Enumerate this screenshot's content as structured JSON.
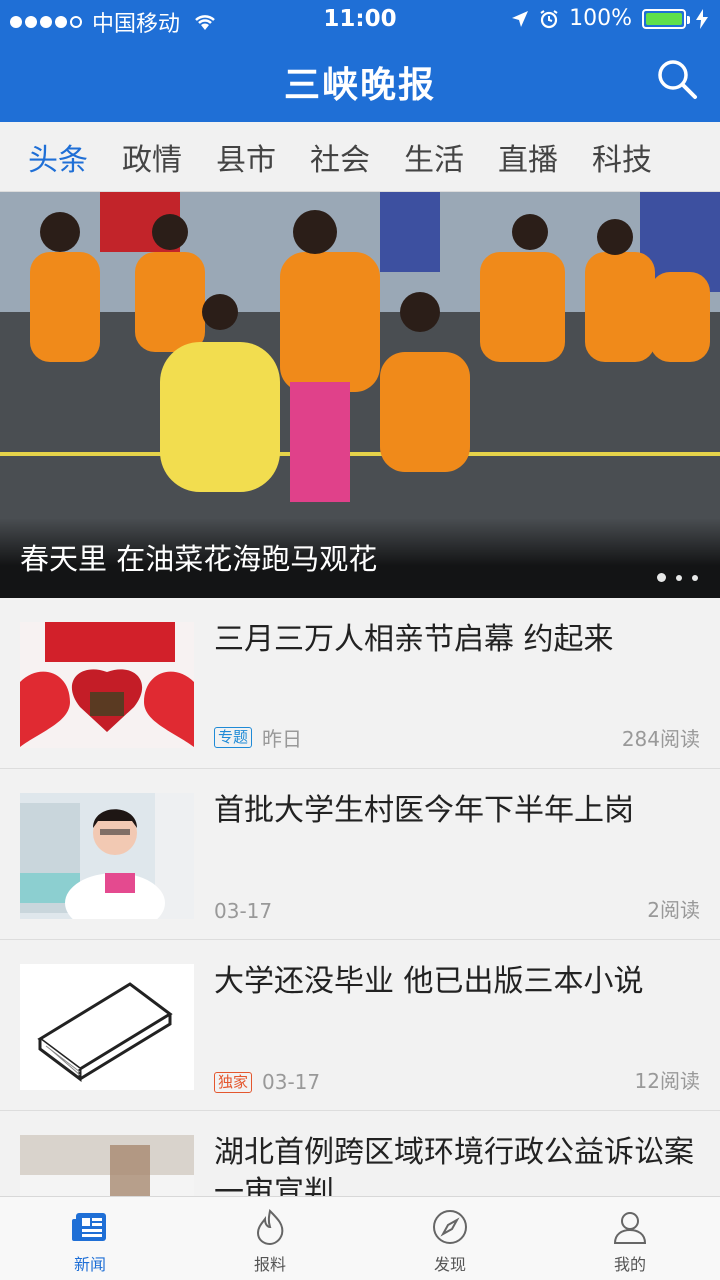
{
  "status": {
    "carrier": "中国移动",
    "time": "11:00",
    "battery": "100%",
    "signal_bars": 4,
    "battery_level": 1.0
  },
  "header": {
    "title": "三峡晚报",
    "search_icon": "search-icon",
    "background": "#1f6fd6"
  },
  "tabs": [
    {
      "label": "头条",
      "active": true
    },
    {
      "label": "政情"
    },
    {
      "label": "县市"
    },
    {
      "label": "社会"
    },
    {
      "label": "生活"
    },
    {
      "label": "直播"
    },
    {
      "label": "科技"
    }
  ],
  "hero": {
    "caption": "春天里 在油菜花海跑马观花",
    "page_count": 3,
    "current_page": 1
  },
  "news": [
    {
      "title": "三月三万人相亲节启幕 约起来",
      "tag": "专题",
      "tag_color": "#1f8ad6",
      "date": "昨日",
      "reads": "284阅读"
    },
    {
      "title": "首批大学生村医今年下半年上岗",
      "tag": "",
      "date": "03-17",
      "reads": "2阅读"
    },
    {
      "title": "大学还没毕业 他已出版三本小说",
      "tag": "独家",
      "tag_color": "#e4572e",
      "date": "03-17",
      "reads": "12阅读"
    },
    {
      "title": "湖北首例跨区域环境行政公益诉讼案一审宣判",
      "tag": "",
      "date": "",
      "reads": ""
    }
  ],
  "bottom_nav": [
    {
      "label": "新闻",
      "icon": "newspaper-icon",
      "active": true
    },
    {
      "label": "报料",
      "icon": "flame-icon"
    },
    {
      "label": "发现",
      "icon": "compass-icon"
    },
    {
      "label": "我的",
      "icon": "user-icon"
    }
  ]
}
